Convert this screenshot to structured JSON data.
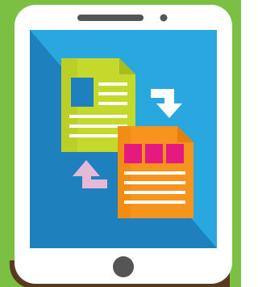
{
  "illustration": {
    "subject": "tablet-file-transfer",
    "colors": {
      "background": "#7bc043",
      "device_body": "#ffffff",
      "device_shadow": "#5a3a1e",
      "screen_light": "#29a8e0",
      "screen_dark": "#1f80be",
      "speaker": "#555555",
      "home_button": "#555555",
      "doc_back": "#c5d92d",
      "doc_back_dark": "#a8bd1f",
      "doc_back_lines": "#ffffff",
      "doc_back_image": "#1f80be",
      "doc_front": "#f7941d",
      "doc_front_dark": "#e47f0a",
      "doc_front_image": "#e6197f",
      "doc_front_lines": "#ffffff",
      "arrow_right": "#ffffff",
      "arrow_left": "#e6b8d8"
    },
    "icons": [
      "document-icon",
      "document-icon",
      "transfer-arrow-icon",
      "transfer-arrow-icon",
      "home-button-icon",
      "speaker-icon",
      "camera-icon"
    ]
  }
}
